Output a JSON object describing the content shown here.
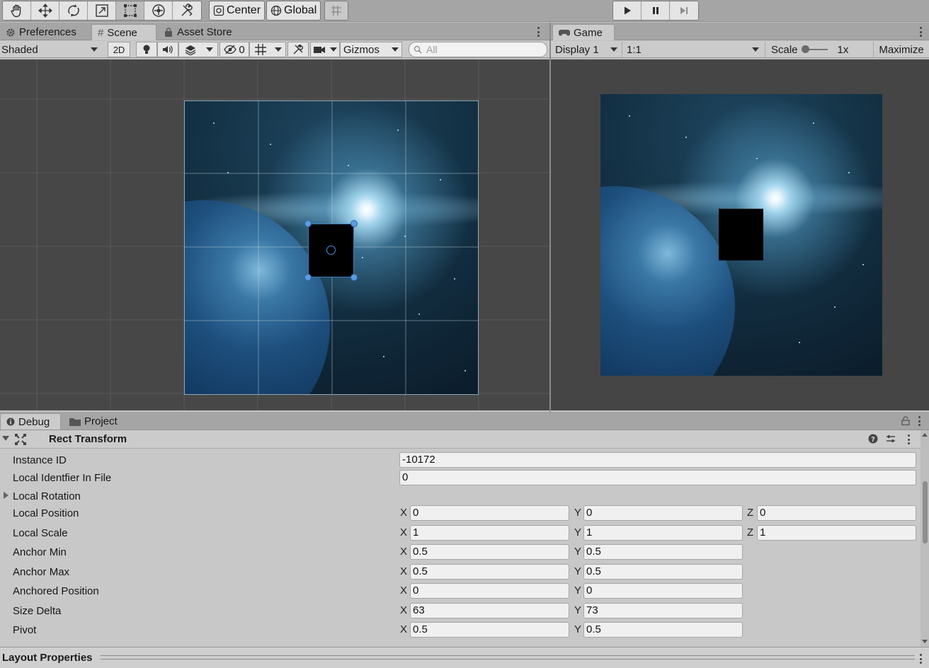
{
  "toolbar": {
    "pivot_label": "Center",
    "space_label": "Global"
  },
  "tabs_left": {
    "preferences": "Preferences",
    "scene": "Scene",
    "asset_store": "Asset Store"
  },
  "tabs_right": {
    "game": "Game"
  },
  "scene_toolbar": {
    "draw_mode": "Shaded",
    "mode_2d": "2D",
    "hidden_count": "0",
    "gizmos": "Gizmos",
    "search_placeholder": "All"
  },
  "game_toolbar": {
    "display": "Display 1",
    "aspect": "1:1",
    "scale_label": "Scale",
    "scale_value": "1x",
    "maximize": "Maximize"
  },
  "bottom_tabs": {
    "debug": "Debug",
    "project": "Project"
  },
  "inspector": {
    "component_title": "Rect Transform",
    "rows": [
      {
        "label": "Instance ID",
        "value": "-10172"
      },
      {
        "label": "Local Identfier In File",
        "value": "0"
      },
      {
        "label": "Local Rotation"
      },
      {
        "label": "Local Position",
        "x": "0",
        "y": "0",
        "z": "0"
      },
      {
        "label": "Local Scale",
        "x": "1",
        "y": "1",
        "z": "1"
      },
      {
        "label": "Anchor Min",
        "x": "0.5",
        "y": "0.5"
      },
      {
        "label": "Anchor Max",
        "x": "0.5",
        "y": "0.5"
      },
      {
        "label": "Anchored Position",
        "x": "0",
        "y": "0"
      },
      {
        "label": "Size Delta",
        "x": "63",
        "y": "73"
      },
      {
        "label": "Pivot",
        "x": "0.5",
        "y": "0.5"
      }
    ],
    "axis": {
      "x": "X",
      "y": "Y",
      "z": "Z"
    },
    "layout_properties": "Layout Properties"
  },
  "colors": {
    "scene_bg": "#474747",
    "game_bg": "#454545",
    "panel_bg": "#c8c8c8"
  }
}
